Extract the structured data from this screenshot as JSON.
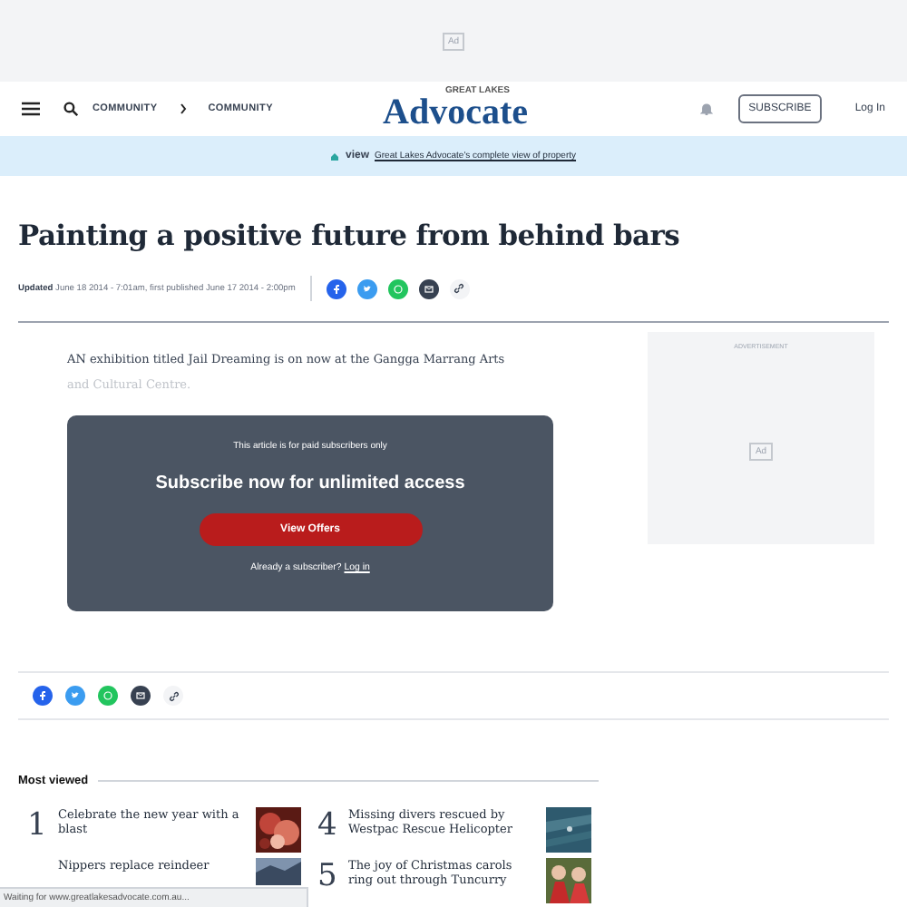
{
  "top_ad": {
    "label": "Ad"
  },
  "header": {
    "breadcrumbs": [
      "COMMUNITY",
      "COMMUNITY"
    ],
    "logo": {
      "small": "GREAT LAKES",
      "name": "Advocate"
    },
    "subscribe": "SUBSCRIBE",
    "login": "Log In"
  },
  "banner": {
    "brand": "view",
    "link": "Great Lakes Advocate's complete view of property"
  },
  "article": {
    "title": "Painting a positive future from behind bars",
    "updated_label": "Updated",
    "dates": "June 18 2014 - 7:01am, first published June 17 2014 - 2:00pm",
    "intro": "AN exhibition titled Jail Dreaming is on now at the Gangga Marrang Arts",
    "intro_faded": "and Cultural Centre."
  },
  "paywall": {
    "note": "This article is for paid subscribers only",
    "heading": "Subscribe now for unlimited access",
    "button": "View Offers",
    "already": "Already a subscriber?",
    "login": "Log in"
  },
  "side_ad": {
    "label": "ADVERTISEMENT",
    "badge": "Ad"
  },
  "most_viewed": {
    "title": "Most viewed",
    "items": [
      {
        "rank": "1",
        "headline": "Celebrate the new year with a blast",
        "kind": "picture"
      },
      {
        "rank": "4",
        "headline": "Missing divers rescued by Westpac Rescue Helicopter",
        "kind": "picture"
      },
      {
        "headline": "Nippers replace reindeer",
        "kind": "picture"
      },
      {
        "rank": "5",
        "headline": "The joy of Christmas carols ring out through Tuncurry",
        "kind": "picture"
      }
    ]
  },
  "status_bar": {
    "text": "Waiting for www.greatlakesadvocate.com.au..."
  }
}
